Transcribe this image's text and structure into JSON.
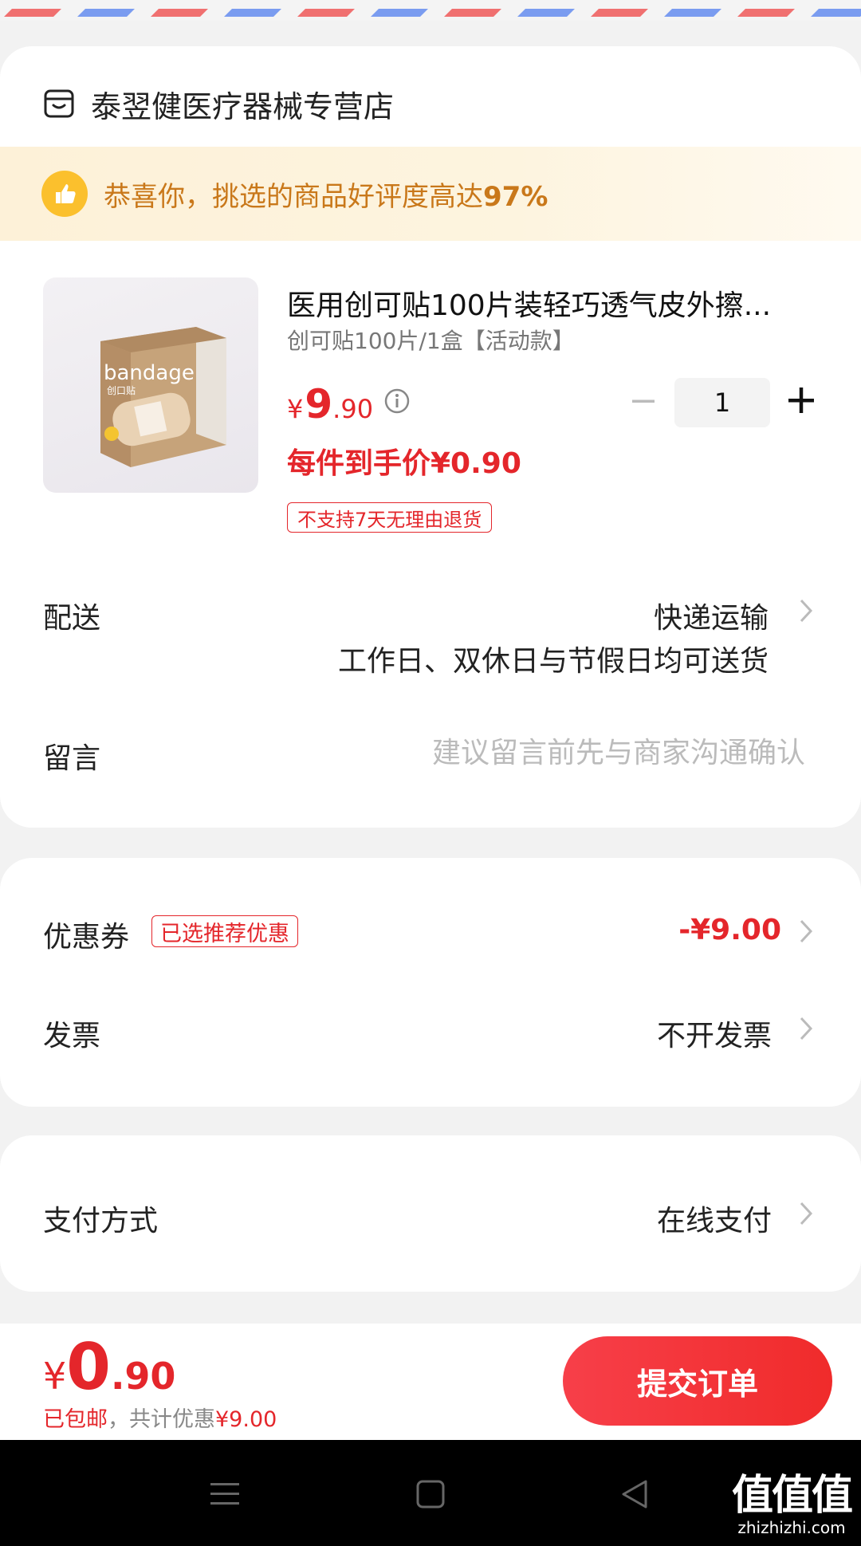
{
  "shop": {
    "name": "泰翌健医疗器械专营店",
    "icon": "shop-icon"
  },
  "praise": {
    "text": "恭喜你，挑选的商品好评度高达",
    "percent": "97%",
    "icon": "thumbs-up-icon"
  },
  "product": {
    "title": "医用创可贴100片装轻巧透气皮外擦...",
    "spec": "创可贴100片/1盒【活动款】",
    "price_currency": "¥",
    "price_int": "9",
    "price_dec": ".90",
    "per_item_price": "每件到手价¥0.90",
    "return_tag": "不支持7天无理由退货",
    "quantity": "1",
    "image_brand": "bandage",
    "image_subtitle": "创口贴"
  },
  "delivery": {
    "label": "配送",
    "value": "快递运输",
    "sub": "工作日、双休日与节假日均可送货"
  },
  "note": {
    "label": "留言",
    "placeholder": "建议留言前先与商家沟通确认"
  },
  "coupon": {
    "label": "优惠券",
    "tag": "已选推荐优惠",
    "value": "-¥9.00"
  },
  "invoice": {
    "label": "发票",
    "value": "不开发票"
  },
  "payment": {
    "label": "支付方式",
    "value": "在线支付"
  },
  "footer": {
    "total_currency": "¥",
    "total_int": "0",
    "total_dec": ".90",
    "shipping": "已包邮",
    "discount_text": "，共计优惠",
    "discount_value": "¥9.00",
    "submit_label": "提交订单"
  },
  "watermark": {
    "big": "值值值",
    "small": "zhizhizhi.com"
  },
  "colors": {
    "accent": "#e4262b",
    "praise": "#c9781a",
    "praise_bg": "#fdf1d8"
  }
}
